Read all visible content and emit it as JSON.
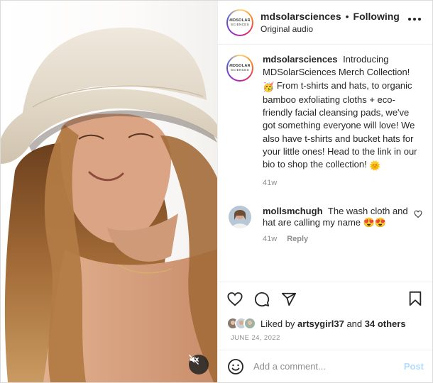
{
  "media": {
    "subject": "woman in bucket hat",
    "mute_icon": "speaker-muted-icon"
  },
  "header": {
    "username": "mdsolarsciences",
    "separator": "•",
    "follow_status": "Following",
    "audio_label": "Original audio",
    "more_icon": "more-dots-icon",
    "logo_main": "MDSOLAR",
    "logo_sub": "SCIENCES"
  },
  "caption": {
    "username": "mdsolarsciences",
    "text_1": "Introducing MDSolarSciences Merch Collection!",
    "text_2": "From t-shirts and hats, to organic bamboo exfoliating cloths + eco-friendly facial cleansing pads, we've got something everyone will love! We also have t-shirts and bucket hats for your little ones! Head to the link in our bio to shop the collection!",
    "emoji_party": "🥳",
    "emoji_sun": "🌞",
    "time": "41w"
  },
  "comment": {
    "username": "mollsmchugh",
    "text": "The wash cloth and hat are calling my name",
    "emojis": "😍😍",
    "time": "41w",
    "reply_label": "Reply",
    "like_icon": "heart-outline-icon"
  },
  "actions": {
    "like_icon": "heart-icon",
    "comment_icon": "comment-bubble-icon",
    "share_icon": "paper-plane-icon",
    "save_icon": "bookmark-icon"
  },
  "likes": {
    "prefix": "Liked by",
    "user": "artsygirl37",
    "joiner": "and",
    "others": "34 others"
  },
  "date": "JUNE 24, 2022",
  "add_comment": {
    "placeholder": "Add a comment...",
    "post_label": "Post",
    "emoji_icon": "smiley-icon"
  },
  "colors": {
    "text": "#262626",
    "muted": "#8e8e8e",
    "post_disabled": "#b3dbff",
    "border": "#efefef"
  }
}
